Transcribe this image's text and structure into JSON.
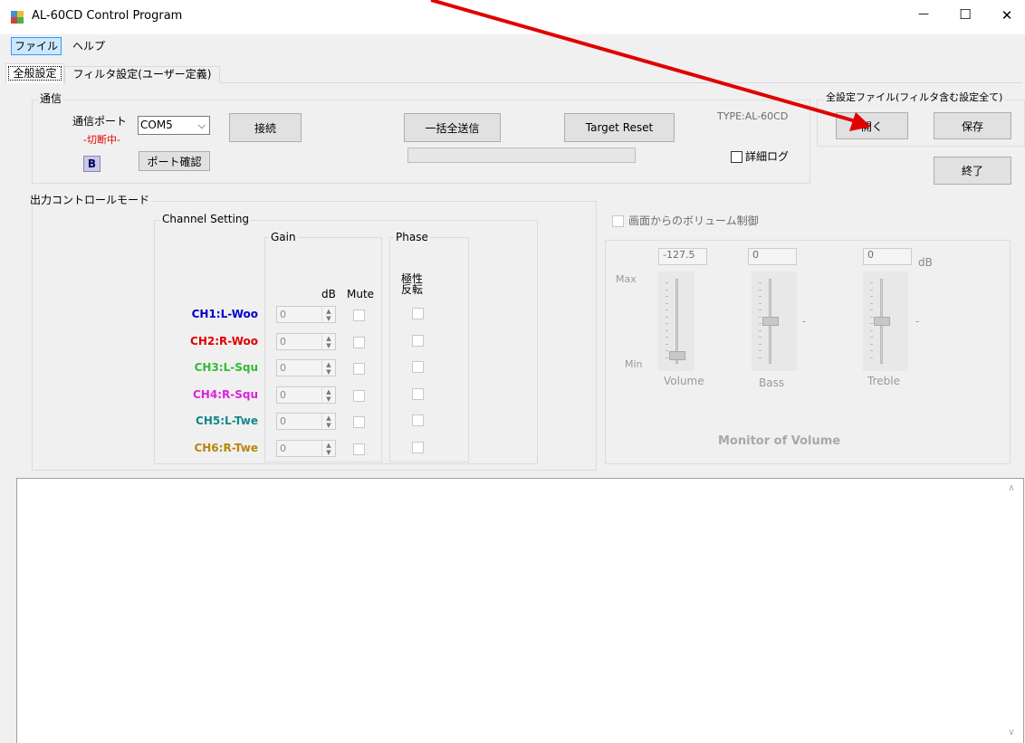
{
  "window": {
    "title": "AL-60CD Control Program",
    "min": "—",
    "max": "☐",
    "close": "✕"
  },
  "menu": {
    "file": "ファイル",
    "help": "ヘルプ"
  },
  "tabs": {
    "general": "全般設定",
    "filter": "フィルタ設定(ユーザー定義)"
  },
  "comm": {
    "group": "通信",
    "port_label": "通信ポート",
    "port_value": "COM5",
    "status": "-切断中-",
    "b_button": "B",
    "connect": "接続",
    "port_check": "ポート確認",
    "send_all": "一括全送信",
    "target_reset": "Target Reset",
    "type": "TYPE:AL-60CD",
    "detail_log": "詳細ログ"
  },
  "file_settings": {
    "group": "全設定ファイル(フィルタ含む設定全て)",
    "open": "開く",
    "save": "保存",
    "exit": "終了"
  },
  "output": {
    "group": "出力コントロールモード",
    "channel_setting": "Channel Setting",
    "gain": "Gain",
    "phase": "Phase",
    "db": "dB",
    "mute": "Mute",
    "polarity": "極性\n反転"
  },
  "channels": [
    {
      "label": "CH1:L-Woo",
      "color": "#0000cc",
      "gain": "0"
    },
    {
      "label": "CH2:R-Woo",
      "color": "#e00000",
      "gain": "0"
    },
    {
      "label": "CH3:L-Squ",
      "color": "#33bb33",
      "gain": "0"
    },
    {
      "label": "CH4:R-Squ",
      "color": "#dd22dd",
      "gain": "0"
    },
    {
      "label": "CH5:L-Twe",
      "color": "#118888",
      "gain": "0"
    },
    {
      "label": "CH6:R-Twe",
      "color": "#b8860b",
      "gain": "0"
    }
  ],
  "volume": {
    "screen_control": "画面からのボリューム制御",
    "vol_value": "-127.5",
    "bass_value": "0",
    "treble_value": "0",
    "db_unit": "dB",
    "max": "Max",
    "min": "Min",
    "vol_label": "Volume",
    "bass_label": "Bass",
    "treble_label": "Treble",
    "dash": "-",
    "monitor": "Monitor of Volume"
  },
  "log": {
    "content": ""
  },
  "colors": {
    "annotation_arrow": "#e00000",
    "window_bg": "#f0f0f0",
    "log_bg": "#ffffff"
  }
}
